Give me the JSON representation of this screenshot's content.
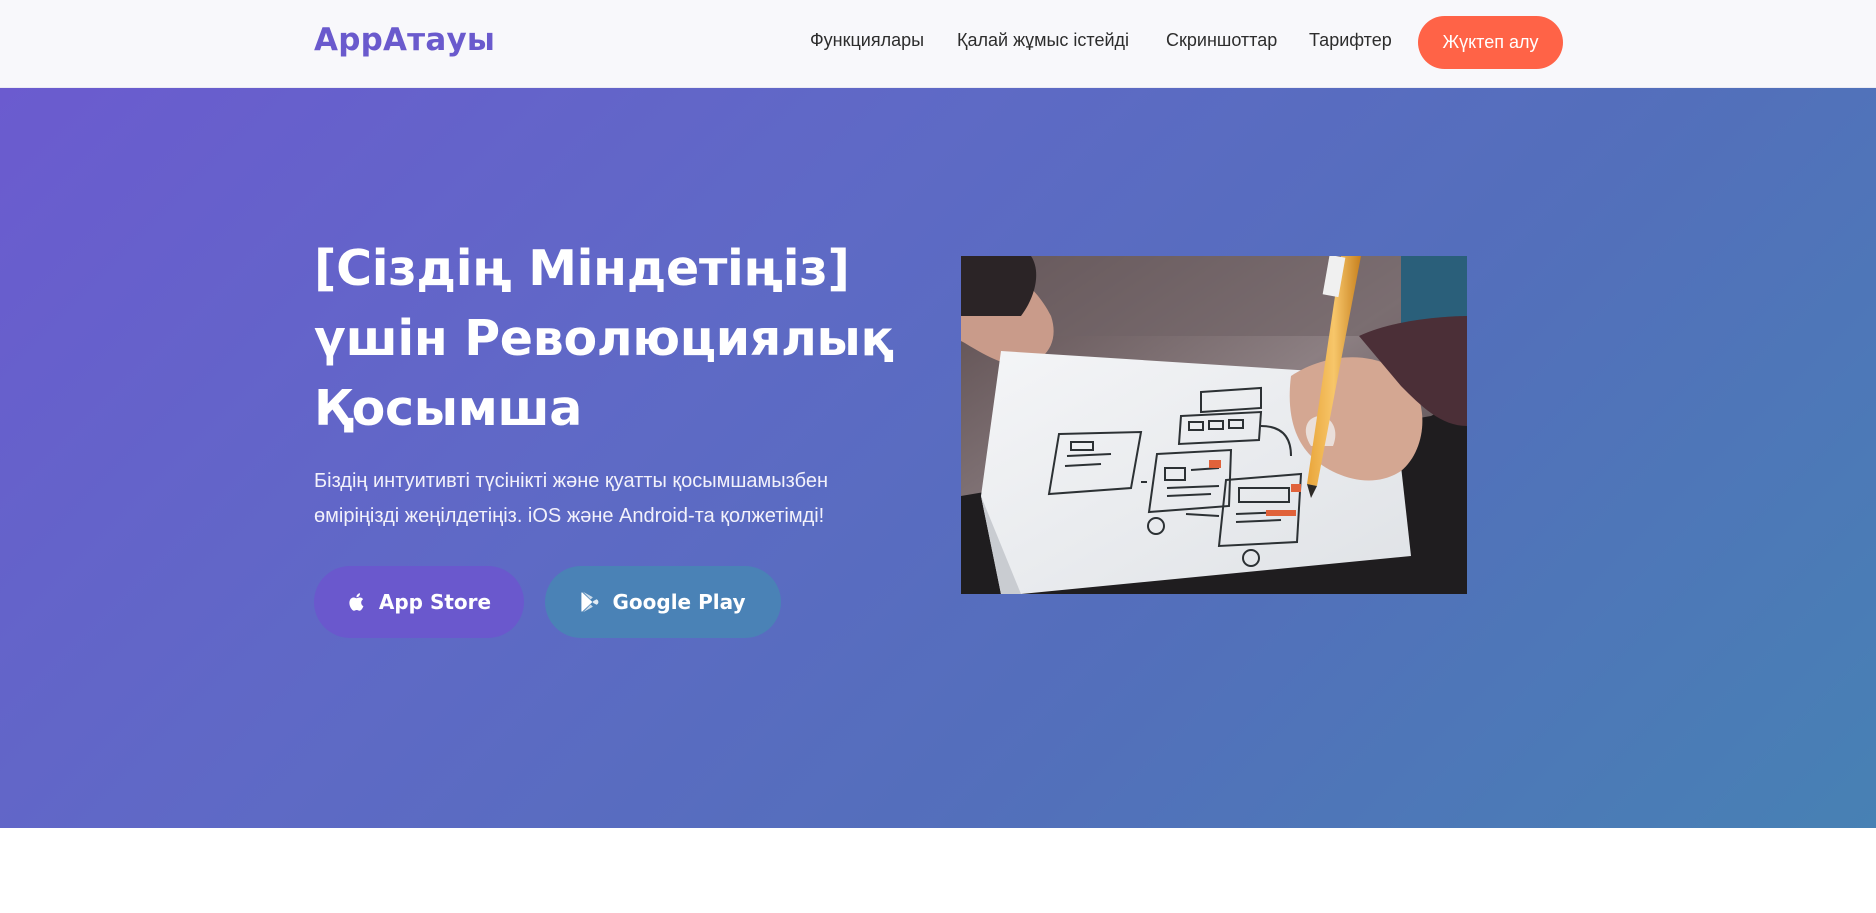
{
  "brand": {
    "logo_text": "AppАтауы"
  },
  "nav": {
    "links": [
      {
        "label": "Функциялары"
      },
      {
        "label": "Қалай жұмыс істейді"
      },
      {
        "label": "Скриншоттар"
      },
      {
        "label": "Тарифтер"
      }
    ],
    "cta_label": "Жүктеп алу"
  },
  "hero": {
    "title": "[Сіздің Міндетіңіз] үшін Революциялық Қосымша",
    "description": "Біздің интуитивті түсінікті және қуатты қосымшамызбен өміріңізді жеңілдетіңіз. iOS және Android-та қолжетімді!",
    "buttons": {
      "app_store": {
        "label": "App Store",
        "icon": "apple-icon"
      },
      "google_play": {
        "label": "Google Play",
        "icon": "google-play-icon"
      }
    },
    "image": {
      "subject": "hand-sketching-app-wireframes"
    }
  },
  "colors": {
    "brand": "#6a5acd",
    "cta": "#ff6347",
    "hero_gradient_start": "#6b5bcf",
    "hero_gradient_end": "#4781b4",
    "app_store_button": "#6a58cd",
    "google_play_button": "#4a82b6"
  }
}
